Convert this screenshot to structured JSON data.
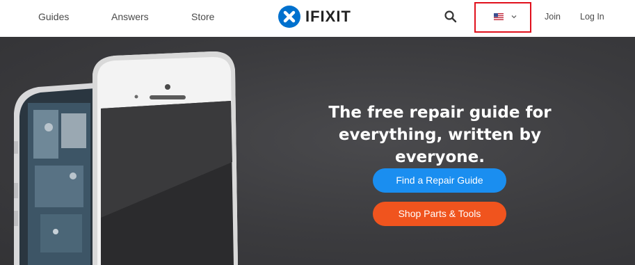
{
  "nav": {
    "guides": "Guides",
    "answers": "Answers",
    "store": "Store",
    "logo_text": "IFIXIT",
    "join": "Join",
    "login": "Log In"
  },
  "locale": {
    "icon": "us-flag-icon"
  },
  "hero": {
    "tagline_line1": "The free repair guide for",
    "tagline_line2": "everything, written by everyone.",
    "cta_primary": "Find a Repair Guide",
    "cta_secondary": "Shop Parts & Tools"
  },
  "colors": {
    "brand_blue": "#0071ce",
    "cta_blue": "#1a8ef0",
    "cta_orange": "#f0541e",
    "highlight_red": "#e0101c",
    "hero_bg": "#3b3b3e"
  }
}
